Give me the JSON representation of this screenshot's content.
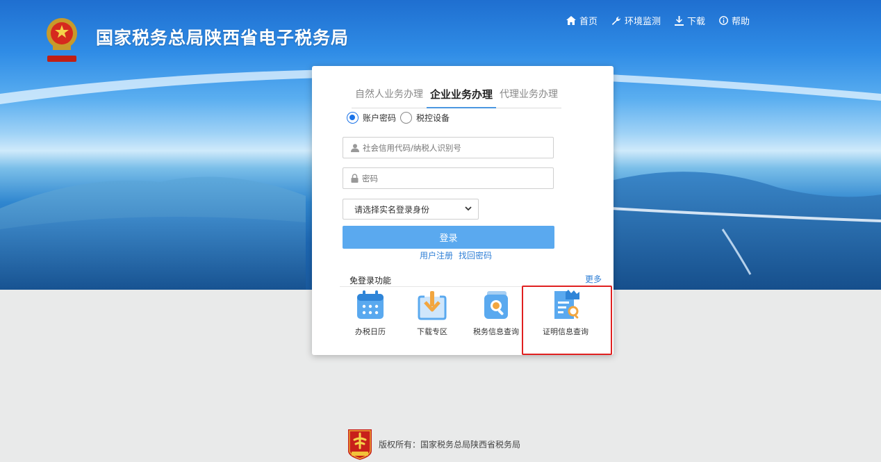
{
  "header": {
    "site_title": "国家税务总局陕西省电子税务局",
    "nav": [
      {
        "label": "首页",
        "icon": "home-icon"
      },
      {
        "label": "环境监测",
        "icon": "wrench-icon"
      },
      {
        "label": "下载",
        "icon": "download-icon"
      },
      {
        "label": "帮助",
        "icon": "info-icon"
      }
    ]
  },
  "login": {
    "tabs": [
      "自然人业务办理",
      "企业业务办理",
      "代理业务办理"
    ],
    "active_tab": "企业业务办理",
    "radios": [
      {
        "label": "账户密码",
        "checked": true
      },
      {
        "label": "税控设备",
        "checked": false
      }
    ],
    "username_placeholder": "社会信用代码/纳税人识别号",
    "password_placeholder": "密码",
    "identity_select": "请选择实名登录身份",
    "submit_label": "登录",
    "register_link": "用户注册",
    "recover_link": "找回密码"
  },
  "quick_access": {
    "title": "免登录功能",
    "more_label": "更多",
    "items": [
      {
        "label": "办税日历",
        "icon": "calendar-icon"
      },
      {
        "label": "下载专区",
        "icon": "download-zone-icon"
      },
      {
        "label": "税务信息查询",
        "icon": "tax-info-search-icon"
      },
      {
        "label": "证明信息查询",
        "icon": "certificate-search-icon"
      }
    ]
  },
  "footer": {
    "copyright": "版权所有：国家税务总局陕西省税务局"
  },
  "colors": {
    "primary_blue": "#5aa9ef",
    "link_blue": "#2f7fd6",
    "highlight_red": "#e02020"
  }
}
